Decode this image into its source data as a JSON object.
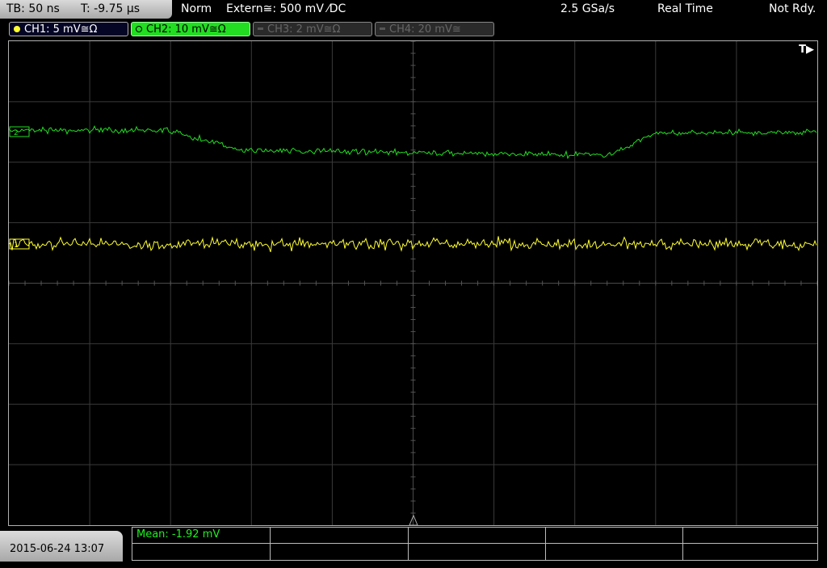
{
  "header": {
    "timebase": "TB: 50 ns",
    "trigger_time": "T: -9.75 µs",
    "trigger_mode": "Norm",
    "trigger_source": "Extern≅: 500 mV ⁄DC",
    "sample_rate": "2.5 GSa/s",
    "acq_mode": "Real Time",
    "status": "Not Rdy."
  },
  "channels": [
    {
      "label": "CH1: 5 mV≅Ω",
      "color": "#ffff30",
      "state": "on"
    },
    {
      "label": "CH2: 10 mV≅Ω",
      "color": "#22dd22",
      "state": "selected"
    },
    {
      "label": "CH3: 2 mV≅Ω",
      "color": "#666666",
      "state": "off"
    },
    {
      "label": "CH4: 20 mV≅",
      "color": "#666666",
      "state": "off"
    }
  ],
  "screen": {
    "trigger_indicator": "T▶",
    "ch2_marker": "2",
    "ch1_marker": "1"
  },
  "footer": {
    "datetime": "2015-06-24 13:07",
    "measurement": "Mean: -1.92 mV"
  }
}
